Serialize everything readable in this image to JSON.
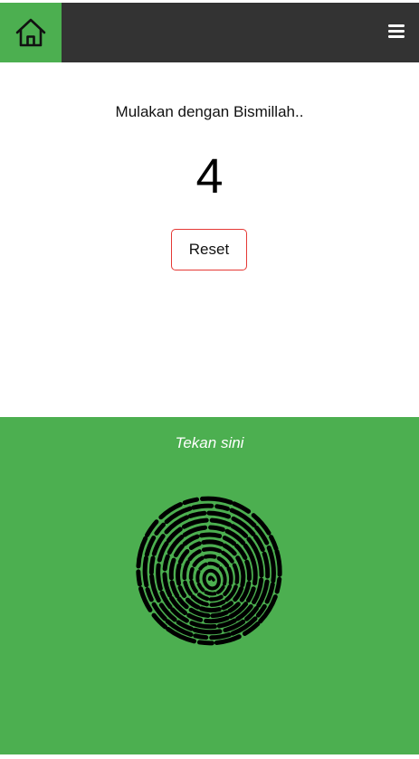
{
  "navbar": {
    "home_icon": "home-icon",
    "menu_icon": "hamburger-menu-icon"
  },
  "main": {
    "intro_text": "Mulakan dengan Bismillah..",
    "counter_value": "4",
    "reset_label": "Reset"
  },
  "tap_area": {
    "label": "Tekan sini",
    "icon": "fingerprint-icon"
  },
  "colors": {
    "navbar_bg": "#333333",
    "accent_green": "#4caf50",
    "reset_border": "#e53935"
  }
}
